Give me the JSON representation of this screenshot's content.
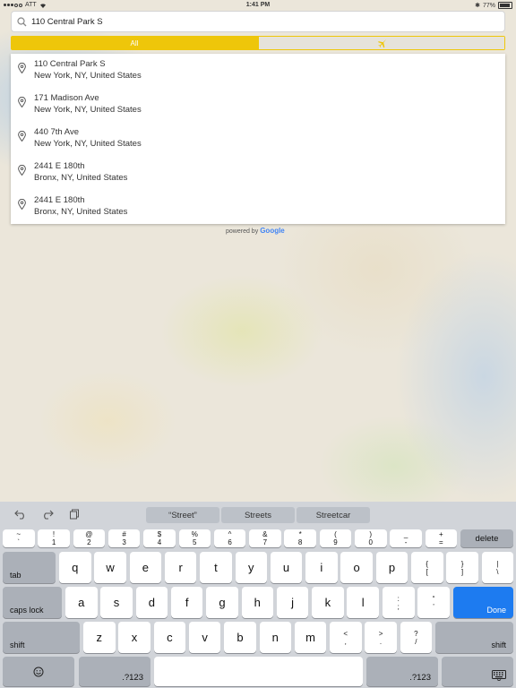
{
  "status": {
    "carrier": "ATT",
    "time": "1:41 PM",
    "battery": "77%"
  },
  "search": {
    "value": "110 Central Park S"
  },
  "segments": {
    "all": "All",
    "airport_icon": "airplane-icon"
  },
  "results": [
    {
      "line1": "110 Central Park S",
      "line2": "New York, NY, United States"
    },
    {
      "line1": "171 Madison Ave",
      "line2": "New York, NY, United States"
    },
    {
      "line1": "440 7th Ave",
      "line2": "New York, NY, United States"
    },
    {
      "line1": "2441 E 180th",
      "line2": "Bronx, NY, United States"
    },
    {
      "line1": "2441 E 180th",
      "line2": "Bronx, NY, United States"
    }
  ],
  "powered": {
    "prefix": "powered by",
    "brand": "Google"
  },
  "keyboard": {
    "suggestions": [
      "“Street”",
      "Streets",
      "Streetcar"
    ],
    "number_row": [
      {
        "top": "~",
        "bottom": "`"
      },
      {
        "top": "!",
        "bottom": "1"
      },
      {
        "top": "@",
        "bottom": "2"
      },
      {
        "top": "#",
        "bottom": "3"
      },
      {
        "top": "$",
        "bottom": "4"
      },
      {
        "top": "%",
        "bottom": "5"
      },
      {
        "top": "^",
        "bottom": "6"
      },
      {
        "top": "&",
        "bottom": "7"
      },
      {
        "top": "*",
        "bottom": "8"
      },
      {
        "top": "(",
        "bottom": "9"
      },
      {
        "top": ")",
        "bottom": "0"
      },
      {
        "top": "_",
        "bottom": "-"
      },
      {
        "top": "+",
        "bottom": "="
      }
    ],
    "delete": "delete",
    "tab": "tab",
    "row_q": [
      "q",
      "w",
      "e",
      "r",
      "t",
      "y",
      "u",
      "i",
      "o",
      "p"
    ],
    "row_q_extra": [
      {
        "top": "{",
        "bottom": "["
      },
      {
        "top": "}",
        "bottom": "]"
      },
      {
        "top": "|",
        "bottom": "\\"
      }
    ],
    "caps_lock": "caps lock",
    "row_a": [
      "a",
      "s",
      "d",
      "f",
      "g",
      "h",
      "j",
      "k",
      "l"
    ],
    "row_a_extra": [
      {
        "top": ":",
        "bottom": ";"
      },
      {
        "top": "“",
        "bottom": "’"
      }
    ],
    "done": "Done",
    "shift": "shift",
    "row_z": [
      "z",
      "x",
      "c",
      "v",
      "b",
      "n",
      "m"
    ],
    "row_z_extra": [
      {
        "top": "<",
        "bottom": ","
      },
      {
        "top": ">",
        "bottom": "."
      },
      {
        "top": "?",
        "bottom": "/"
      }
    ],
    "numbers_key": ".?123",
    "done_color": "#1d7bf0"
  }
}
